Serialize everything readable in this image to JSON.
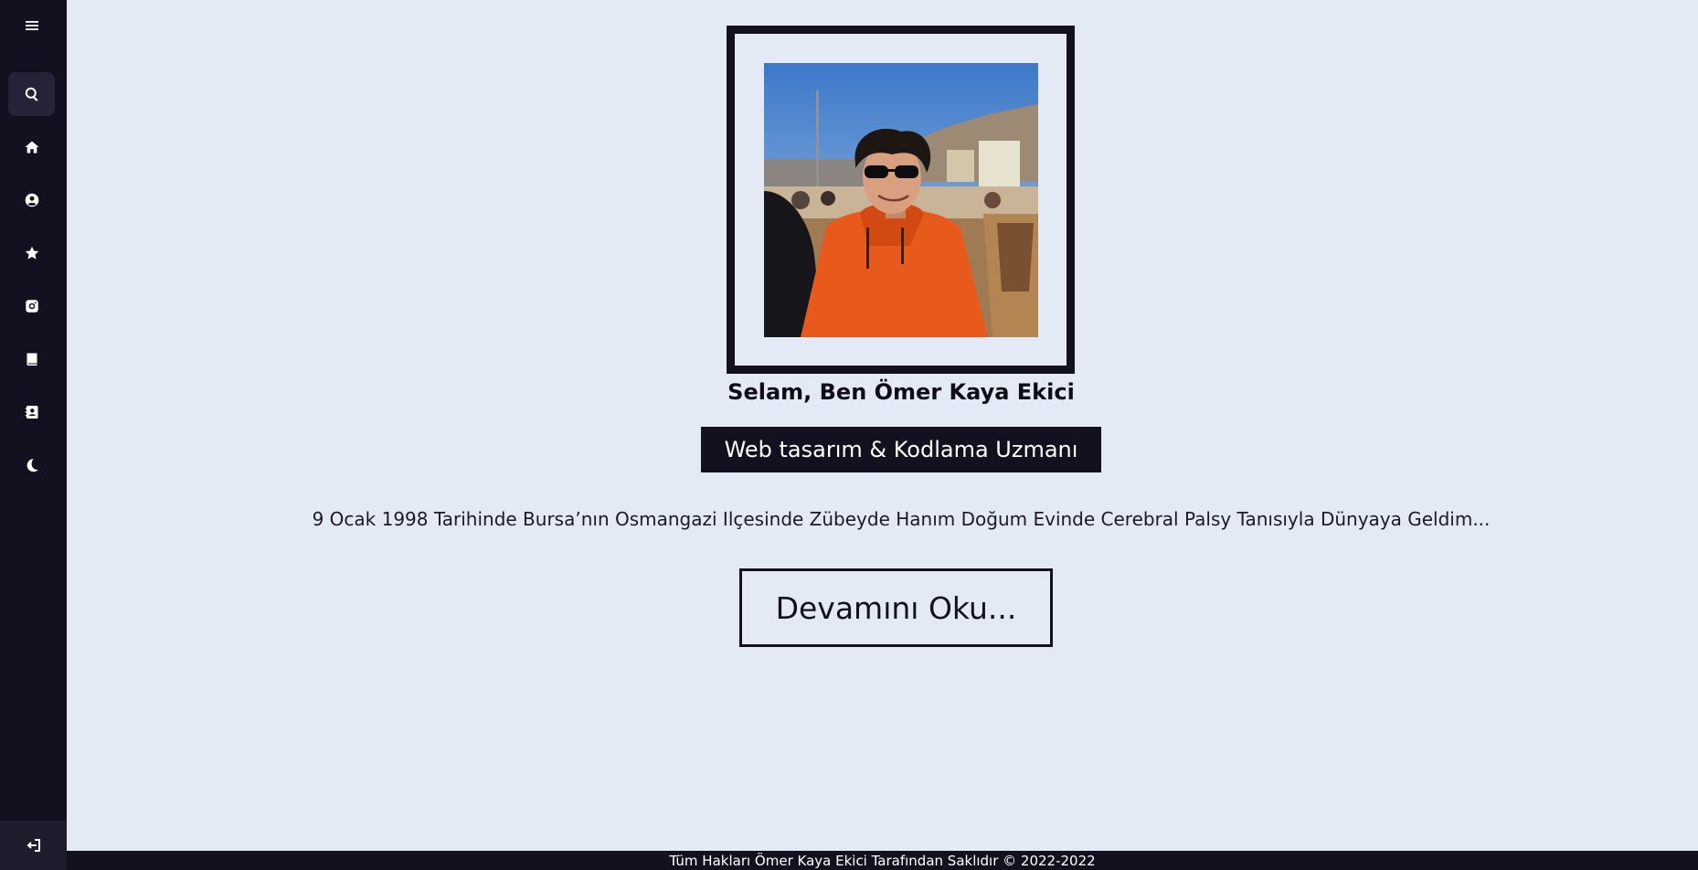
{
  "sidebar": {
    "items": [
      {
        "icon": "menu-icon"
      },
      {
        "icon": "search-icon"
      },
      {
        "icon": "home-icon"
      },
      {
        "icon": "user-icon"
      },
      {
        "icon": "star-icon"
      },
      {
        "icon": "camera-icon"
      },
      {
        "icon": "book-icon"
      },
      {
        "icon": "contact-card-icon"
      },
      {
        "icon": "moon-icon"
      }
    ],
    "bottom_icon": "logout-icon"
  },
  "profile": {
    "photo_icon": "profile-photo",
    "greeting": "Selam, Ben Ömer Kaya Ekici",
    "role": "Web tasarım & Kodlama Uzmanı",
    "bio": "9 Ocak 1998 Tarihinde Bursa’nın Osmangazi Ilçesinde Zübeyde Hanım Doğum Evinde Cerebral Palsy Tanısıyla Dünyaya Geldim...",
    "read_more": "Devamını Oku..."
  },
  "footer": {
    "text": "Tüm Hakları Ömer Kaya Ekici Tarafından Saklıdır © 2022-2022"
  },
  "colors": {
    "background": "#e4e9f6",
    "sidebar": "#13111f",
    "accent": "#13111f",
    "hoodie": "#e85a1c"
  }
}
